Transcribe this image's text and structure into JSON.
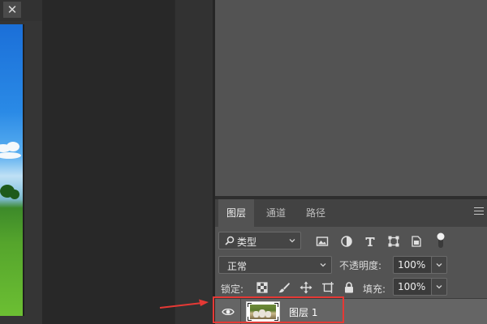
{
  "document": {
    "close_glyph": "✕"
  },
  "layers_panel": {
    "tabs": [
      {
        "label": "图层",
        "active": true
      },
      {
        "label": "通道",
        "active": false
      },
      {
        "label": "路径",
        "active": false
      }
    ],
    "kind_filter": {
      "label": "类型",
      "icon": "search-icon"
    },
    "filter_icons": [
      "image-filter-icon",
      "adjustment-filter-icon",
      "type-filter-icon",
      "shape-filter-icon",
      "smart-object-filter-icon",
      "filter-toggle-icon"
    ],
    "blend_mode": "正常",
    "opacity_label": "不透明度:",
    "opacity_value": "100%",
    "lock_label": "锁定:",
    "lock_icons": [
      "lock-transparent-icon",
      "lock-image-icon",
      "lock-position-icon",
      "lock-artboard-icon",
      "lock-all-icon"
    ],
    "fill_label": "填充:",
    "fill_value": "100%",
    "layers": [
      {
        "name": "图层 1",
        "visible": true,
        "selected": true
      }
    ]
  },
  "annotation": {
    "color": "#e53935"
  }
}
